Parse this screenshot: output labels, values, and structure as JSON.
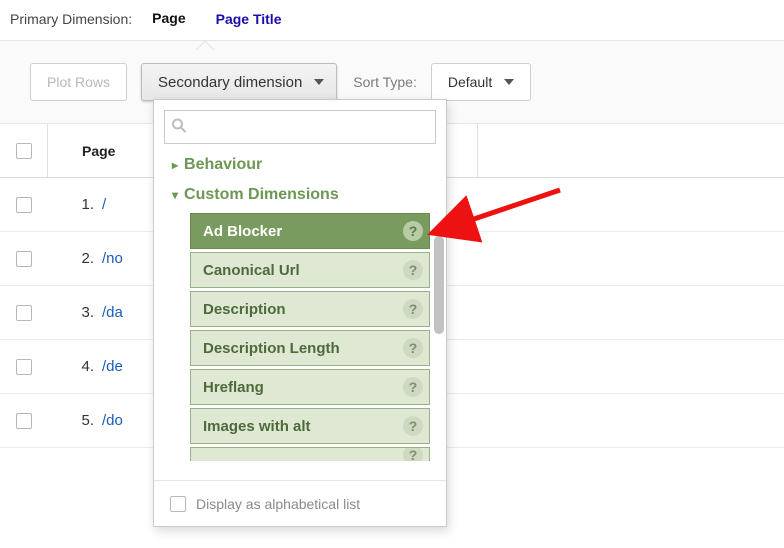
{
  "primary": {
    "label": "Primary Dimension:",
    "tabs": [
      {
        "label": "Page",
        "active": true
      },
      {
        "label": "Page Title",
        "active": false
      }
    ]
  },
  "toolbar": {
    "plot_rows": "Plot Rows",
    "secondary_dim": "Secondary dimension",
    "sort_type_label": "Sort Type:",
    "sort_default": "Default"
  },
  "table": {
    "header_page": "Page",
    "rows": [
      {
        "idx": "1.",
        "page": "/"
      },
      {
        "idx": "2.",
        "page": "/no"
      },
      {
        "idx": "3.",
        "page": "/da"
      },
      {
        "idx": "4.",
        "page": "/de"
      },
      {
        "idx": "5.",
        "page": "/do"
      }
    ]
  },
  "popover": {
    "search_placeholder": "",
    "groups": [
      {
        "label": "Behaviour",
        "expanded": false
      },
      {
        "label": "Custom Dimensions",
        "expanded": true,
        "items": [
          {
            "label": "Ad Blocker",
            "selected": true
          },
          {
            "label": "Canonical Url"
          },
          {
            "label": "Description"
          },
          {
            "label": "Description Length"
          },
          {
            "label": "Hreflang"
          },
          {
            "label": "Images with alt"
          }
        ]
      }
    ],
    "footer": "Display as alphabetical list"
  }
}
